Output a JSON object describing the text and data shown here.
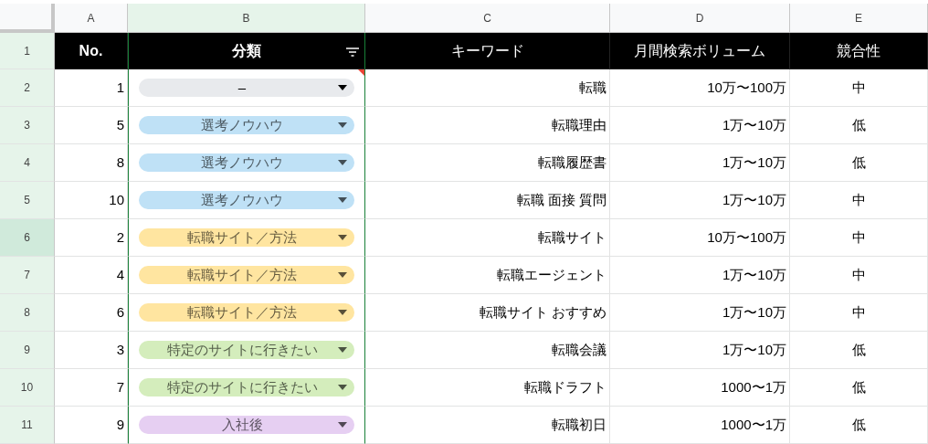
{
  "columns": [
    {
      "letter": "A",
      "selected": false
    },
    {
      "letter": "B",
      "selected": true
    },
    {
      "letter": "C",
      "selected": false
    },
    {
      "letter": "D",
      "selected": false
    },
    {
      "letter": "E",
      "selected": false
    }
  ],
  "header_row": {
    "number": "1",
    "cells": [
      {
        "text": "No.",
        "bold": true
      },
      {
        "text": "分類",
        "bold": true,
        "filter": true
      },
      {
        "text": "キーワード",
        "bold": false
      },
      {
        "text": "月間検索ボリューム",
        "bold": false
      },
      {
        "text": "競合性",
        "bold": false
      }
    ]
  },
  "rows": [
    {
      "number": "2",
      "highlighted": false,
      "no": "1",
      "category": {
        "label": "–",
        "color": "#e8eaed",
        "has_note": true
      },
      "keyword": "転職",
      "volume": "10万〜100万",
      "competition": "中"
    },
    {
      "number": "3",
      "highlighted": false,
      "no": "5",
      "category": {
        "label": "選考ノウハウ",
        "color": "#bfe1f6",
        "has_note": false
      },
      "keyword": "転職理由",
      "volume": "1万〜10万",
      "competition": "低"
    },
    {
      "number": "4",
      "highlighted": false,
      "no": "8",
      "category": {
        "label": "選考ノウハウ",
        "color": "#bfe1f6",
        "has_note": false
      },
      "keyword": "転職履歴書",
      "volume": "1万〜10万",
      "competition": "低"
    },
    {
      "number": "5",
      "highlighted": false,
      "no": "10",
      "category": {
        "label": "選考ノウハウ",
        "color": "#bfe1f6",
        "has_note": false
      },
      "keyword": "転職 面接 質問",
      "volume": "1万〜10万",
      "competition": "中"
    },
    {
      "number": "6",
      "highlighted": true,
      "no": "2",
      "category": {
        "label": "転職サイト／方法",
        "color": "#ffe5a0",
        "has_note": false
      },
      "keyword": "転職サイト",
      "volume": "10万〜100万",
      "competition": "中"
    },
    {
      "number": "7",
      "highlighted": false,
      "no": "4",
      "category": {
        "label": "転職サイト／方法",
        "color": "#ffe5a0",
        "has_note": false
      },
      "keyword": "転職エージェント",
      "volume": "1万〜10万",
      "competition": "中"
    },
    {
      "number": "8",
      "highlighted": false,
      "no": "6",
      "category": {
        "label": "転職サイト／方法",
        "color": "#ffe5a0",
        "has_note": false
      },
      "keyword": "転職サイト おすすめ",
      "volume": "1万〜10万",
      "competition": "中"
    },
    {
      "number": "9",
      "highlighted": false,
      "no": "3",
      "category": {
        "label": "特定のサイトに行きたい",
        "color": "#d4edbc",
        "has_note": false
      },
      "keyword": "転職会議",
      "volume": "1万〜10万",
      "competition": "低"
    },
    {
      "number": "10",
      "highlighted": false,
      "no": "7",
      "category": {
        "label": "特定のサイトに行きたい",
        "color": "#d4edbc",
        "has_note": false
      },
      "keyword": "転職ドラフト",
      "volume": "1000〜1万",
      "competition": "低"
    },
    {
      "number": "11",
      "highlighted": false,
      "no": "9",
      "category": {
        "label": "入社後",
        "color": "#e6cff2",
        "has_note": false
      },
      "keyword": "転職初日",
      "volume": "1000〜1万",
      "competition": "低"
    }
  ]
}
